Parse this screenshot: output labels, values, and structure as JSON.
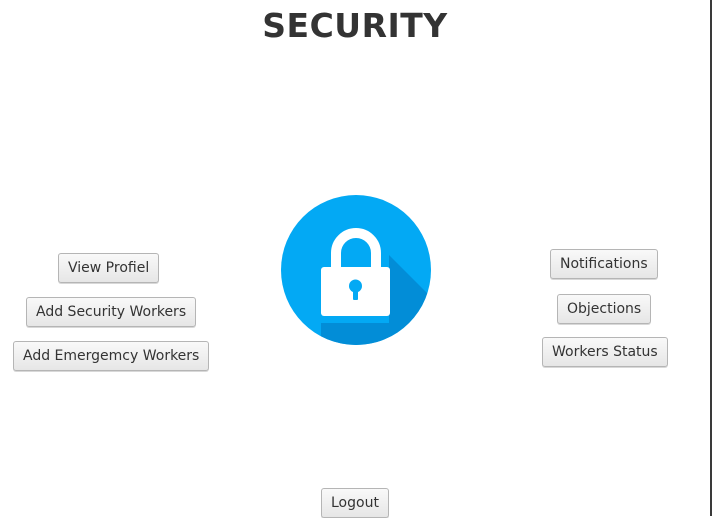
{
  "page": {
    "title": "SECURITY"
  },
  "left_actions": {
    "view_profile": "View Profiel",
    "add_security_workers": "Add Security Workers",
    "add_emergency_workers": "Add Emergemcy Workers"
  },
  "right_actions": {
    "notifications": "Notifications",
    "objections": "Objections",
    "workers_status": "Workers Status"
  },
  "footer": {
    "logout": "Logout"
  },
  "icon": {
    "name": "lock-icon",
    "circle_color": "#03A9F4",
    "shadow_color": "#0288D1",
    "lock_color": "#FFFFFF"
  }
}
